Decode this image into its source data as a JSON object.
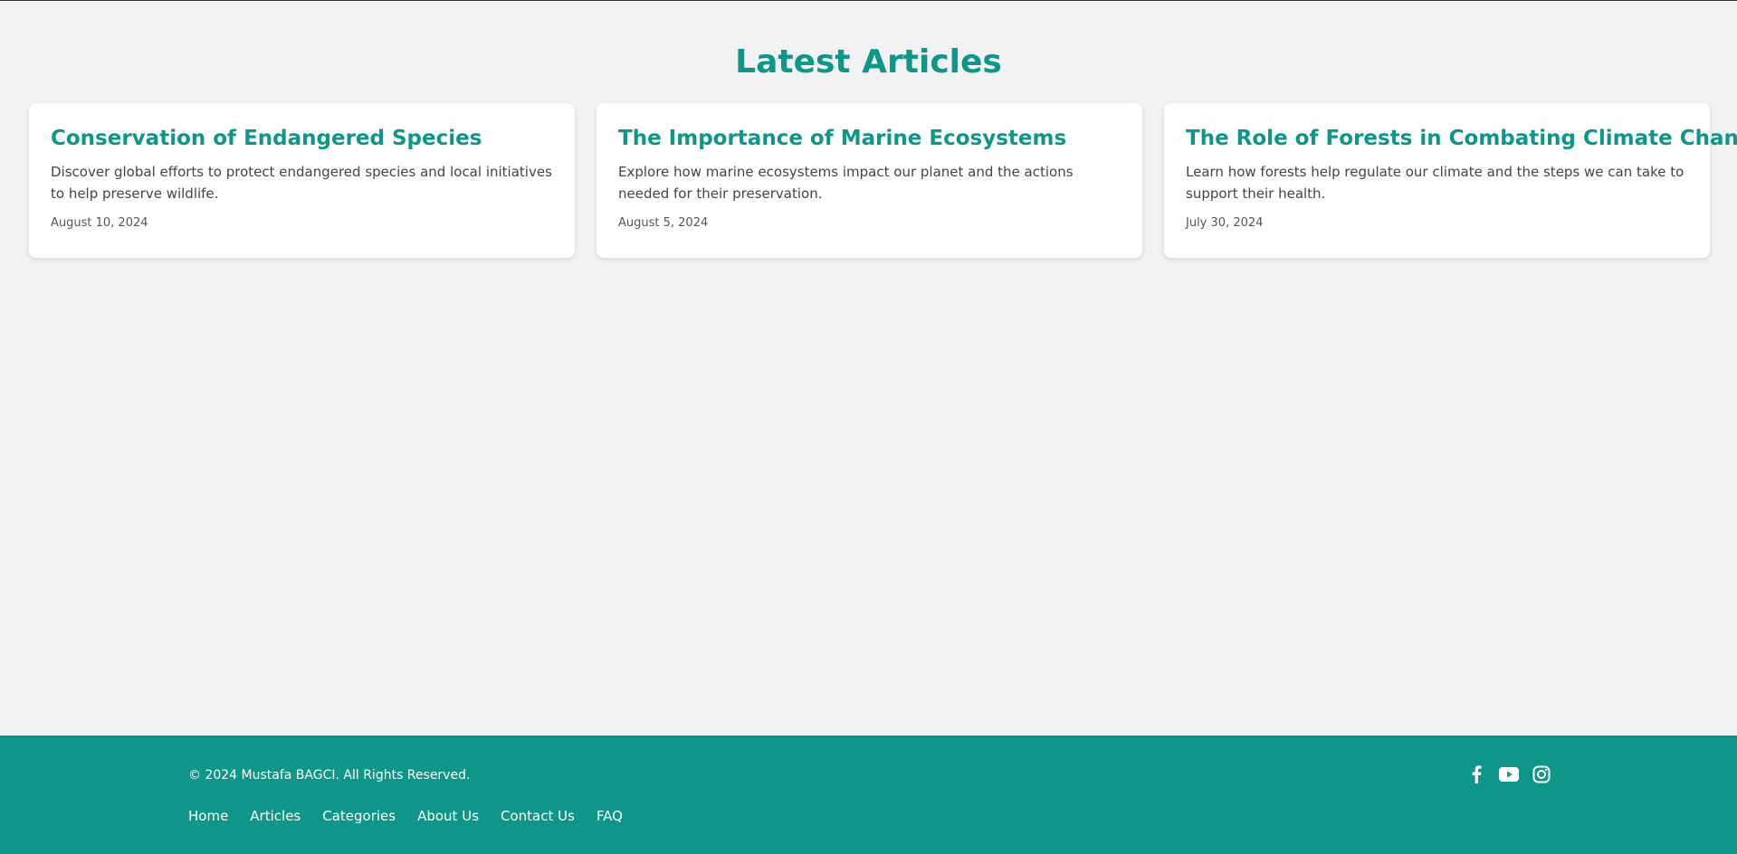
{
  "main": {
    "title": "Latest Articles",
    "articles": [
      {
        "title": "Conservation of Endangered Species",
        "description": "Discover global efforts to protect endangered species and local initiatives to help preserve wildlife.",
        "date": "August 10, 2024"
      },
      {
        "title": "The Importance of Marine Ecosystems",
        "description": "Explore how marine ecosystems impact our planet and the actions needed for their preservation.",
        "date": "August 5, 2024"
      },
      {
        "title": "The Role of Forests in Combating Climate Change",
        "description": "Learn how forests help regulate our climate and the steps we can take to support their health.",
        "date": "July 30, 2024"
      }
    ]
  },
  "footer": {
    "copyright": "© 2024 Mustafa BAGCI. All Rights Reserved.",
    "nav": [
      "Home",
      "Articles",
      "Categories",
      "About Us",
      "Contact Us",
      "FAQ"
    ],
    "social_icons": [
      "facebook-icon",
      "youtube-icon",
      "instagram-icon"
    ]
  },
  "colors": {
    "accent": "#0e9688",
    "background": "#f2f2f2",
    "card": "#ffffff"
  }
}
